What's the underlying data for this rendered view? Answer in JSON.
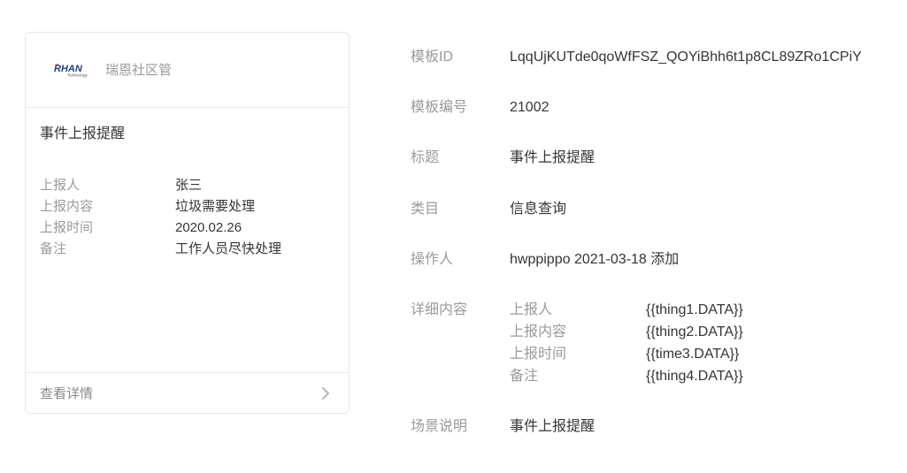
{
  "card": {
    "logo": {
      "brand": "RHAN",
      "tagline": "Technology"
    },
    "account_name": "瑞恩社区管",
    "title": "事件上报提醒",
    "fields": [
      {
        "label": "上报人",
        "value": "张三"
      },
      {
        "label": "上报内容",
        "value": "垃圾需要处理"
      },
      {
        "label": "上报时间",
        "value": "2020.02.26"
      },
      {
        "label": "备注",
        "value": "工作人员尽快处理"
      }
    ],
    "footer_label": "查看详情",
    "footer_icon": "chevron-right-icon"
  },
  "details": {
    "template_id": {
      "label": "模板ID",
      "value": "LqqUjKUTde0qoWfFSZ_QOYiBhh6t1p8CL89ZRo1CPiY"
    },
    "template_no": {
      "label": "模板编号",
      "value": "21002"
    },
    "title": {
      "label": "标题",
      "value": "事件上报提醒"
    },
    "category": {
      "label": "类目",
      "value": "信息查询"
    },
    "operator": {
      "label": "操作人",
      "value": "hwppippo 2021-03-18 添加"
    },
    "content": {
      "label": "详细内容",
      "items": [
        {
          "label": "上报人",
          "value": "{{thing1.DATA}}"
        },
        {
          "label": "上报内容",
          "value": "{{thing2.DATA}}"
        },
        {
          "label": "上报时间",
          "value": "{{time3.DATA}}"
        },
        {
          "label": "备注",
          "value": "{{thing4.DATA}}"
        }
      ]
    },
    "scene": {
      "label": "场景说明",
      "value": "事件上报提醒"
    }
  },
  "colors": {
    "text": "#353535",
    "label": "#9a9a9a",
    "border": "#e6e6e6",
    "logo_blue": "#1d3f8f",
    "logo_red": "#e0322b"
  }
}
